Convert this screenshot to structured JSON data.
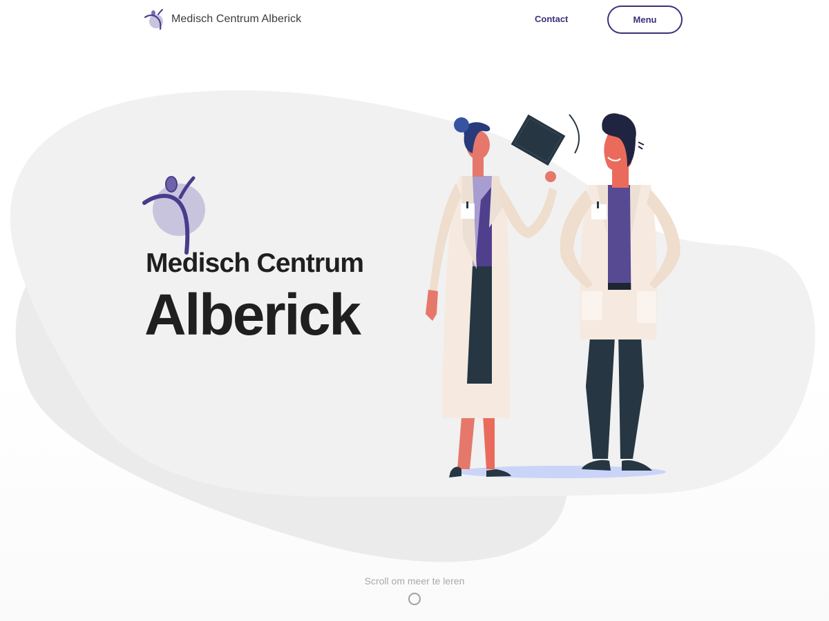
{
  "header": {
    "brand_name": "Medisch Centrum Alberick",
    "contact_label": "Contact",
    "menu_label": "Menu"
  },
  "hero": {
    "line1": "Medisch Centrum",
    "line2": "Alberick"
  },
  "scroll": {
    "hint": "Scroll om meer te leren"
  },
  "icons": {
    "brand": "medical-center-logo",
    "scroll": "scroll-circle-icon"
  },
  "colors": {
    "accent": "#3d2f7a",
    "logo_circle": "#c9c4de",
    "logo_figure": "#4a3b8c",
    "blob": "#f1f1f1",
    "text_dark": "#1f1f1f",
    "muted": "#a8a8a8"
  }
}
